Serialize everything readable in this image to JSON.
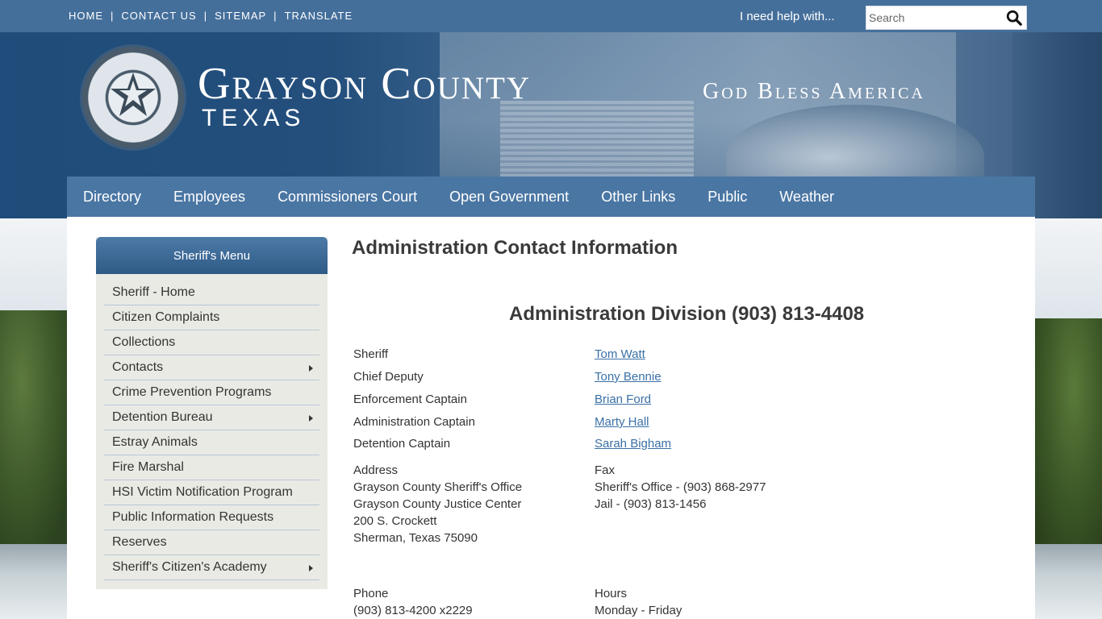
{
  "topbar": {
    "links": [
      "HOME",
      "CONTACT US",
      "SITEMAP",
      "TRANSLATE"
    ],
    "help_text": "I need help with...",
    "search_placeholder": "Search"
  },
  "header": {
    "title": "Grayson County",
    "subtitle": "TEXAS",
    "motto": "God Bless America"
  },
  "mainnav": [
    "Directory",
    "Employees",
    "Commissioners Court",
    "Open Government",
    "Other Links",
    "Public",
    "Weather"
  ],
  "sidebar": {
    "title": "Sheriff's Menu",
    "items": [
      {
        "label": "Sheriff - Home",
        "submenu": false
      },
      {
        "label": "Citizen Complaints",
        "submenu": false
      },
      {
        "label": "Collections",
        "submenu": false
      },
      {
        "label": "Contacts",
        "submenu": true
      },
      {
        "label": "Crime Prevention Programs",
        "submenu": false
      },
      {
        "label": "Detention Bureau",
        "submenu": true
      },
      {
        "label": "Estray Animals",
        "submenu": false
      },
      {
        "label": "Fire Marshal",
        "submenu": false
      },
      {
        "label": "HSI Victim Notification Program",
        "submenu": false
      },
      {
        "label": "Public Information Requests",
        "submenu": false
      },
      {
        "label": "Reserves",
        "submenu": false
      },
      {
        "label": "Sheriff's Citizen's Academy",
        "submenu": true
      }
    ]
  },
  "main": {
    "title": "Administration Contact Information",
    "division": "Administration Division (903) 813-4408",
    "contacts": [
      {
        "role": "Sheriff",
        "name": "Tom Watt"
      },
      {
        "role": "Chief Deputy",
        "name": "Tony Bennie"
      },
      {
        "role": "Enforcement Captain",
        "name": "Brian Ford"
      },
      {
        "role": "Administration Captain",
        "name": "Marty Hall"
      },
      {
        "role": "Detention Captain",
        "name": "Sarah Bigham"
      }
    ],
    "address": {
      "label": "Address",
      "lines": [
        "Grayson County Sheriff's Office",
        "Grayson County Justice Center",
        "200 S. Crockett",
        "Sherman, Texas 75090"
      ]
    },
    "fax": {
      "label": "Fax",
      "lines": [
        "Sheriff's Office - (903) 868-2977",
        "Jail - (903) 813-1456"
      ]
    },
    "phone": {
      "label": "Phone",
      "lines": [
        "(903) 813-4200 x2229"
      ]
    },
    "hours": {
      "label": "Hours",
      "lines": [
        "Monday - Friday"
      ]
    }
  }
}
